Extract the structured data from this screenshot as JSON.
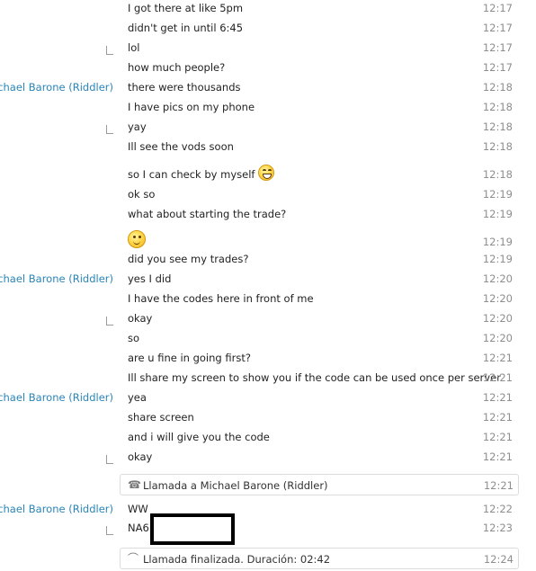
{
  "messages": [
    {
      "sender": "",
      "cont": false,
      "text": "I got there at like 5pm",
      "time": "12:17"
    },
    {
      "sender": "",
      "cont": false,
      "text": "didn't get in until 6:45",
      "time": "12:17"
    },
    {
      "sender": "",
      "cont": true,
      "text": "lol",
      "time": "12:17"
    },
    {
      "sender": "",
      "cont": false,
      "text": "how much people?",
      "time": "12:17"
    },
    {
      "sender": "Michael Barone (Riddler)",
      "cont": false,
      "text": "there were thousands",
      "time": "12:18"
    },
    {
      "sender": "",
      "cont": false,
      "text": "I have pics on my phone",
      "time": "12:18"
    },
    {
      "sender": "",
      "cont": true,
      "text": "yay",
      "time": "12:18"
    },
    {
      "sender": "",
      "cont": false,
      "text": "Ill see the vods soon",
      "time": "12:18"
    },
    {
      "sender": "",
      "cont": false,
      "text": "so I can check by myself",
      "emoji": "laughing-emoji",
      "time": "12:18"
    },
    {
      "sender": "",
      "cont": false,
      "text": "ok so",
      "time": "12:19"
    },
    {
      "sender": "",
      "cont": false,
      "text": "what about starting the trade?",
      "time": "12:19"
    },
    {
      "sender": "",
      "cont": false,
      "text": "",
      "emoji": "smile-emoji",
      "time": "12:19"
    },
    {
      "sender": "",
      "cont": false,
      "text": "did you see my trades?",
      "time": "12:19"
    },
    {
      "sender": "Michael Barone (Riddler)",
      "cont": false,
      "text": "yes I did",
      "time": "12:20"
    },
    {
      "sender": "",
      "cont": false,
      "text": "I have the codes here in front of me",
      "time": "12:20"
    },
    {
      "sender": "",
      "cont": true,
      "text": "okay",
      "time": "12:20"
    },
    {
      "sender": "",
      "cont": false,
      "text": "so",
      "time": "12:20"
    },
    {
      "sender": "",
      "cont": false,
      "text": "are u fine in going first?",
      "time": "12:21"
    },
    {
      "sender": "",
      "cont": false,
      "text": "Ill share my screen to show you if the code can be used once per server",
      "time": "12:21"
    },
    {
      "sender": "Michael Barone (Riddler)",
      "cont": false,
      "text": "yea",
      "time": "12:21"
    },
    {
      "sender": "",
      "cont": false,
      "text": "share screen",
      "time": "12:21"
    },
    {
      "sender": "",
      "cont": false,
      "text": "and i will give you the code",
      "time": "12:21"
    },
    {
      "sender": "",
      "cont": true,
      "text": "okay",
      "time": "12:21"
    }
  ],
  "call_start": {
    "icon": "phone-icon",
    "text": "Llamada a Michael Barone (Riddler)",
    "time": "12:21"
  },
  "late_messages": [
    {
      "sender": "Michael Barone (Riddler)",
      "cont": false,
      "text": "WW",
      "time": "12:22"
    },
    {
      "sender": "",
      "cont": true,
      "text": "NA6",
      "time": "12:23",
      "redacted": true
    }
  ],
  "call_end": {
    "icon": "hangup-icon",
    "text": "Llamada finalizada. Duración: 02:42",
    "time": "12:24"
  },
  "colors": {
    "sender": "#2a85b8",
    "time": "#8e8e8e",
    "text": "#222222"
  }
}
